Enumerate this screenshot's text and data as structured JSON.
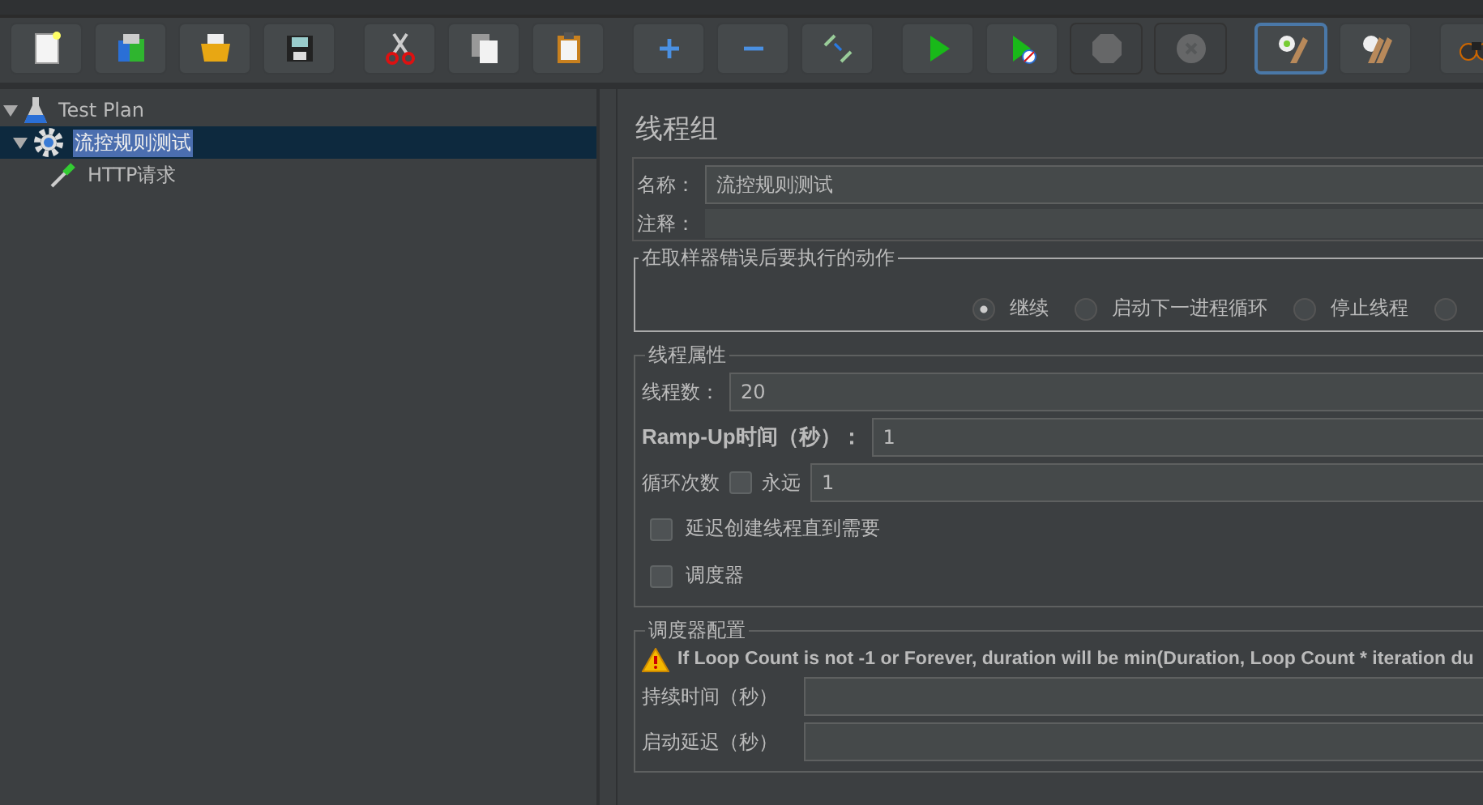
{
  "toolbar": [
    {
      "kind": "new",
      "disabled": false,
      "focused": false
    },
    {
      "kind": "templates",
      "disabled": false,
      "focused": false
    },
    {
      "kind": "open",
      "disabled": false,
      "focused": false
    },
    {
      "kind": "save",
      "disabled": false,
      "focused": false
    },
    {
      "kind": "cut",
      "disabled": false,
      "focused": false
    },
    {
      "kind": "copy",
      "disabled": false,
      "focused": false
    },
    {
      "kind": "paste",
      "disabled": false,
      "focused": false
    },
    {
      "kind": "add",
      "disabled": false,
      "focused": false
    },
    {
      "kind": "remove",
      "disabled": false,
      "focused": false
    },
    {
      "kind": "toggle",
      "disabled": false,
      "focused": false
    },
    {
      "kind": "start",
      "disabled": false,
      "focused": false
    },
    {
      "kind": "start-no-timers",
      "disabled": false,
      "focused": false
    },
    {
      "kind": "stop",
      "disabled": true,
      "focused": false
    },
    {
      "kind": "shutdown",
      "disabled": true,
      "focused": false
    },
    {
      "kind": "clear",
      "disabled": false,
      "focused": true
    },
    {
      "kind": "clear-all",
      "disabled": false,
      "focused": false
    },
    {
      "kind": "search",
      "disabled": false,
      "focused": false
    }
  ],
  "tree": [
    {
      "label": "Test Plan",
      "kind": "plan",
      "expanded": true,
      "selected": false,
      "children": [
        {
          "label": "流控规则测试",
          "kind": "thread-group",
          "expanded": true,
          "selected": true,
          "children": [
            {
              "label": "HTTP请求",
              "kind": "sampler",
              "selected": false
            }
          ]
        }
      ]
    }
  ],
  "panel": {
    "title": "线程组",
    "name": {
      "label": "名称：",
      "value": "流控规则测试"
    },
    "comment": {
      "label": "注释："
    },
    "on_error": {
      "legend": "在取样器错误后要执行的动作",
      "options": [
        {
          "label": "继续",
          "selected": true
        },
        {
          "label": "启动下一进程循环",
          "selected": false
        },
        {
          "label": "停止线程",
          "selected": false
        },
        {
          "selected": false
        }
      ]
    },
    "thread_properties": {
      "legend": "线程属性",
      "threads": {
        "label": "线程数：",
        "value": "20"
      },
      "ramp_up": {
        "label": "Ramp-Up时间（秒）：",
        "value": "1"
      },
      "loop": {
        "label": "循环次数",
        "forever_label": "永远",
        "forever_checked": false,
        "value": "1"
      },
      "delay_create": {
        "label": "延迟创建线程直到需要",
        "checked": false
      },
      "scheduler": {
        "label": "调度器",
        "checked": false
      }
    },
    "scheduler_config": {
      "legend": "调度器配置",
      "warning": "If Loop Count is not -1 or Forever, duration will be min(Duration, Loop Count * iteration du",
      "duration": {
        "label": "持续时间（秒）"
      },
      "startup_delay": {
        "label": "启动延迟（秒）"
      }
    }
  }
}
